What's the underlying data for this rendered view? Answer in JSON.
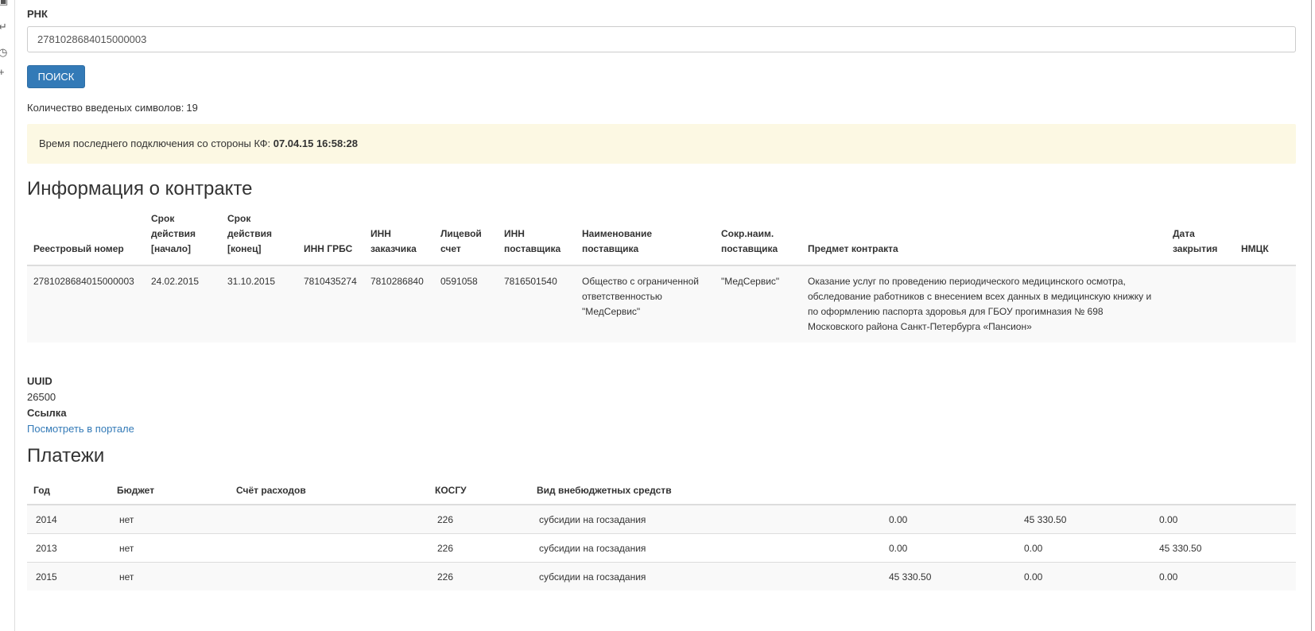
{
  "sidebar_icons": [
    "copy-icon",
    "export-icon",
    "history-icon",
    "plus-icon"
  ],
  "form": {
    "rnk_label": "РНК",
    "rnk_value": "2781028684015000003",
    "search_label": "ПОИСК",
    "count_label": "Количество введеных символов:",
    "count_value": "19"
  },
  "alert": {
    "text": "Время последнего подключения со стороны КФ:",
    "timestamp": "07.04.15 16:58:28"
  },
  "contract": {
    "title": "Информация о контракте",
    "headers": [
      [
        "Реестровый номер"
      ],
      [
        "Срок",
        "действия",
        "[начало]"
      ],
      [
        "Срок",
        "действия",
        "[конец]"
      ],
      [
        "ИНН ГРБС"
      ],
      [
        "ИНН",
        "заказчика"
      ],
      [
        "Лицевой",
        "счет"
      ],
      [
        "ИНН",
        "поставщика"
      ],
      [
        "Наименование",
        "поставщика"
      ],
      [
        "Сокр.наим.",
        "поставщика"
      ],
      [
        "Предмет контракта"
      ],
      [
        "Дата",
        "закрытия"
      ],
      [
        "НМЦК"
      ]
    ],
    "row": [
      "2781028684015000003",
      "24.02.2015",
      "31.10.2015",
      "7810435274",
      "7810286840",
      "0591058",
      "7816501540",
      "Общество с ограниченной ответственностью \"МедСервис\"",
      "\"МедСервис\"",
      "Оказание услуг по проведению периодического медицинского осмотра, обследование работников с внесением всех данных в медицинскую книжку и по оформлению паспорта здоровья для ГБОУ прогимназия № 698 Московского района Санкт-Петербурга «Пансион»",
      "",
      ""
    ]
  },
  "uuid": {
    "label": "UUID",
    "value": "26500",
    "link_label": "Ссылка",
    "link_text": "Посмотреть в портале"
  },
  "payments": {
    "title": "Платежи",
    "headers": [
      "Год",
      "Бюджет",
      "Счёт расходов",
      "КОСГУ",
      "Вид внебюджетных средств",
      "",
      "",
      "",
      ""
    ],
    "rows": [
      [
        "2014",
        "нет",
        "",
        "226",
        "субсидии на госзадания",
        "",
        "0.00",
        "45 330.50",
        "0.00"
      ],
      [
        "2013",
        "нет",
        "",
        "226",
        "субсидии на госзадания",
        "",
        "0.00",
        "0.00",
        "45 330.50"
      ],
      [
        "2015",
        "нет",
        "",
        "226",
        "субсидии на госзадания",
        "",
        "45 330.50",
        "0.00",
        "0.00"
      ]
    ]
  }
}
